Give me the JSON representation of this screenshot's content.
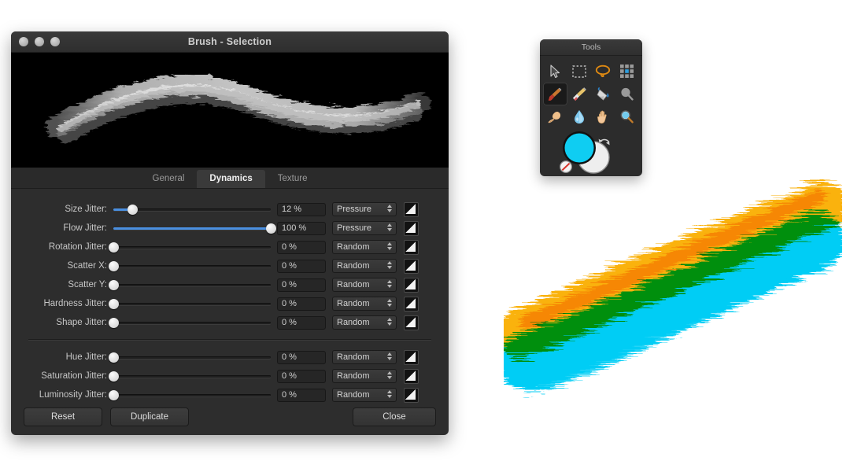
{
  "dialog": {
    "title": "Brush - Selection",
    "window_controls": [
      "close-button",
      "minimize-button",
      "zoom-button"
    ],
    "preview": {
      "name": "brush-stroke-preview",
      "background": "#000000",
      "stroke_color": "#9a9a9a"
    },
    "tabs": [
      {
        "label": "General",
        "active": false
      },
      {
        "label": "Dynamics",
        "active": true
      },
      {
        "label": "Texture",
        "active": false
      }
    ],
    "shape_rows": [
      {
        "label": "Size Jitter:",
        "value": "12 %",
        "percent": 12,
        "mode": "Pressure"
      },
      {
        "label": "Flow Jitter:",
        "value": "100 %",
        "percent": 100,
        "mode": "Pressure"
      },
      {
        "label": "Rotation Jitter:",
        "value": "0 %",
        "percent": 0,
        "mode": "Random"
      },
      {
        "label": "Scatter X:",
        "value": "0 %",
        "percent": 0,
        "mode": "Random"
      },
      {
        "label": "Scatter Y:",
        "value": "0 %",
        "percent": 0,
        "mode": "Random"
      },
      {
        "label": "Hardness Jitter:",
        "value": "0 %",
        "percent": 0,
        "mode": "Random"
      },
      {
        "label": "Shape Jitter:",
        "value": "0 %",
        "percent": 0,
        "mode": "Random"
      }
    ],
    "color_rows": [
      {
        "label": "Hue Jitter:",
        "value": "0 %",
        "percent": 0,
        "mode": "Random"
      },
      {
        "label": "Saturation Jitter:",
        "value": "0 %",
        "percent": 0,
        "mode": "Random"
      },
      {
        "label": "Luminosity Jitter:",
        "value": "0 %",
        "percent": 0,
        "mode": "Random"
      }
    ],
    "mode_options": [
      "Pressure",
      "Random"
    ],
    "footer": {
      "reset_label": "Reset",
      "duplicate_label": "Duplicate",
      "close_label": "Close"
    },
    "colors": {
      "window_bg": "#2d2d2d",
      "slider_fill": "#4a8fe0",
      "text": "#c6c6c6"
    }
  },
  "tools": {
    "title": "Tools",
    "items": [
      {
        "name": "pointer-tool",
        "icon": "arrow-cursor-icon",
        "selected": false
      },
      {
        "name": "rect-select-tool",
        "icon": "marquee-icon",
        "selected": false
      },
      {
        "name": "lasso-tool",
        "icon": "lasso-icon",
        "selected": false
      },
      {
        "name": "pixel-grid-tool",
        "icon": "grid-icon",
        "selected": false
      },
      {
        "name": "paintbrush-tool",
        "icon": "paintbrush-icon",
        "selected": true
      },
      {
        "name": "eraser-tool",
        "icon": "eraser-icon",
        "selected": false
      },
      {
        "name": "paint-bucket-tool",
        "icon": "paint-bucket-icon",
        "selected": false
      },
      {
        "name": "dodge-tool",
        "icon": "dodge-icon",
        "selected": false
      },
      {
        "name": "smudge-tool",
        "icon": "smudge-hand-icon",
        "selected": false
      },
      {
        "name": "blur-tool",
        "icon": "water-drop-icon",
        "selected": false
      },
      {
        "name": "pan-tool",
        "icon": "hand-icon",
        "selected": false
      },
      {
        "name": "zoom-tool",
        "icon": "magnifier-icon",
        "selected": false
      }
    ],
    "swatches": {
      "foreground": "#0fcdf2",
      "background": "#f2f2f2",
      "swap_icon": "swap-colors-icon",
      "none_icon": "no-color-icon"
    }
  },
  "canvas": {
    "name": "painting-canvas",
    "background": "#ffffff",
    "strokes": [
      {
        "name": "orange-brush-stroke",
        "color": "#fab20b"
      },
      {
        "name": "cyan-brush-stroke",
        "color": "#05cdf5"
      }
    ],
    "overlap_color": "#4fc6b8"
  }
}
